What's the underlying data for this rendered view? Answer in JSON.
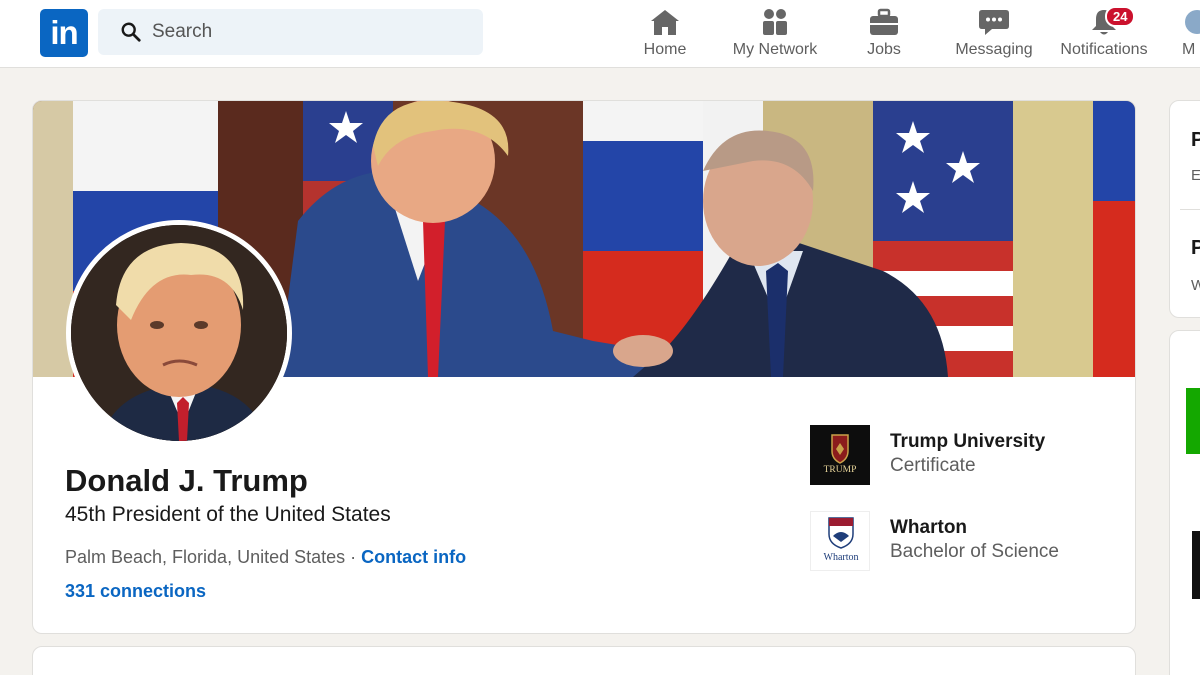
{
  "nav": {
    "logo_text": "in",
    "search_placeholder": "Search",
    "items": [
      {
        "label": "Home",
        "icon": "home-icon"
      },
      {
        "label": "My Network",
        "icon": "people-icon"
      },
      {
        "label": "Jobs",
        "icon": "briefcase-icon"
      },
      {
        "label": "Messaging",
        "icon": "chat-icon"
      },
      {
        "label": "Notifications",
        "icon": "bell-icon",
        "badge": "24"
      },
      {
        "label": "M",
        "icon": "avatar-icon"
      }
    ]
  },
  "profile": {
    "name": "Donald J. Trump",
    "headline": "45th President of the United States",
    "location": "Palm Beach, Florida, United States",
    "separator": "·",
    "contact_info": "Contact info",
    "connections": "331 connections",
    "education": [
      {
        "school": "Trump University",
        "degree": "Certificate",
        "logo_text": "TRUMP"
      },
      {
        "school": "Wharton",
        "degree": "Bachelor of Science",
        "logo_text": "Wharton"
      }
    ]
  },
  "sidebar": {
    "card1": {
      "line1": "P",
      "line2": "E",
      "line3": "P",
      "line4": "W"
    }
  },
  "colors": {
    "brand": "#0a66c2",
    "badge": "#cb112d",
    "page_bg": "#f4f2ee"
  }
}
